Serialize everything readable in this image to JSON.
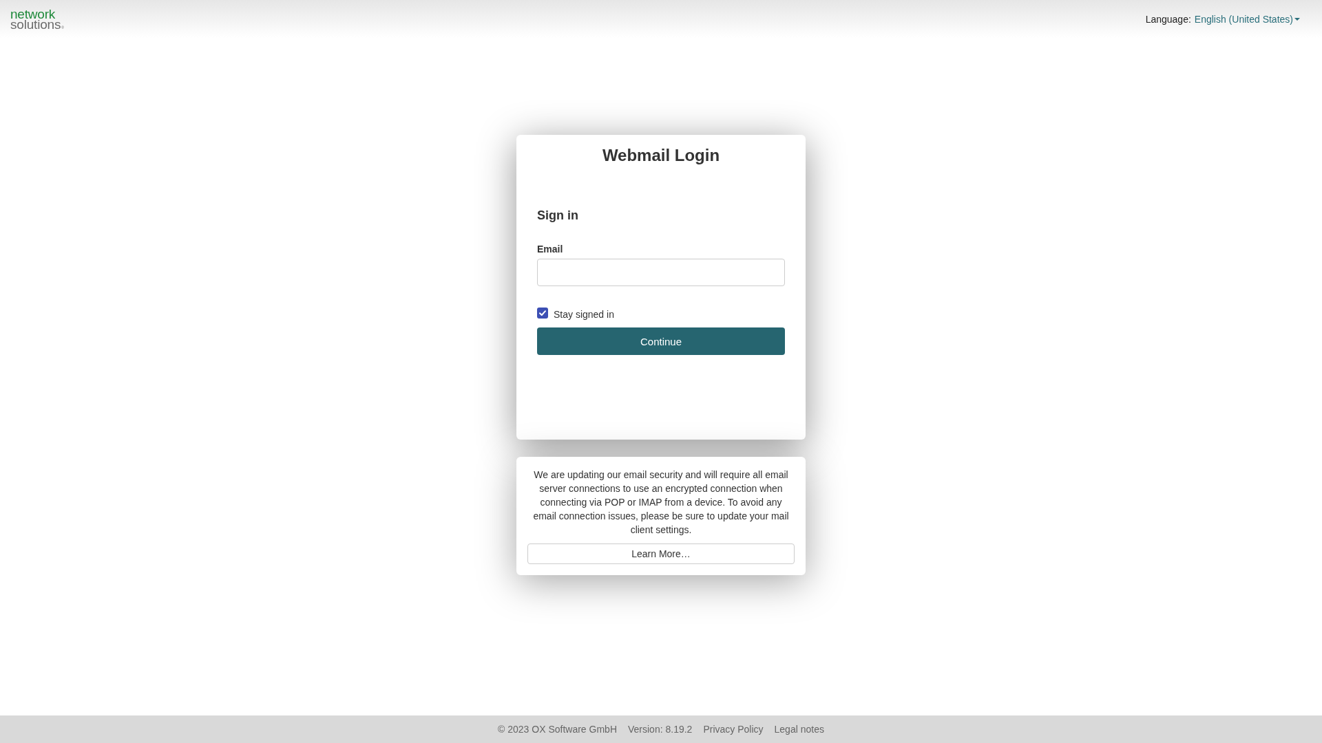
{
  "header": {
    "logo": {
      "line1": "network",
      "line2": "solutions",
      "mark": "®"
    },
    "language": {
      "label": "Language:",
      "value": "English (United States)"
    }
  },
  "login": {
    "title": "Webmail Login",
    "heading": "Sign in",
    "email": {
      "label": "Email"
    },
    "stay_signed_in": {
      "label": "Stay signed in",
      "checked": true
    },
    "button": "Continue"
  },
  "notice": {
    "text": "We are updating our email security and will require all email server connections to use an encrypted connection when connecting via POP or IMAP from a device. To avoid any email connection issues, please be sure to update your mail client settings.",
    "button": "Learn More…"
  },
  "footer": {
    "copyright": "© 2023 OX Software GmbH",
    "version": "Version: 8.19.2",
    "links": [
      "Privacy Policy",
      "Legal notes"
    ]
  }
}
